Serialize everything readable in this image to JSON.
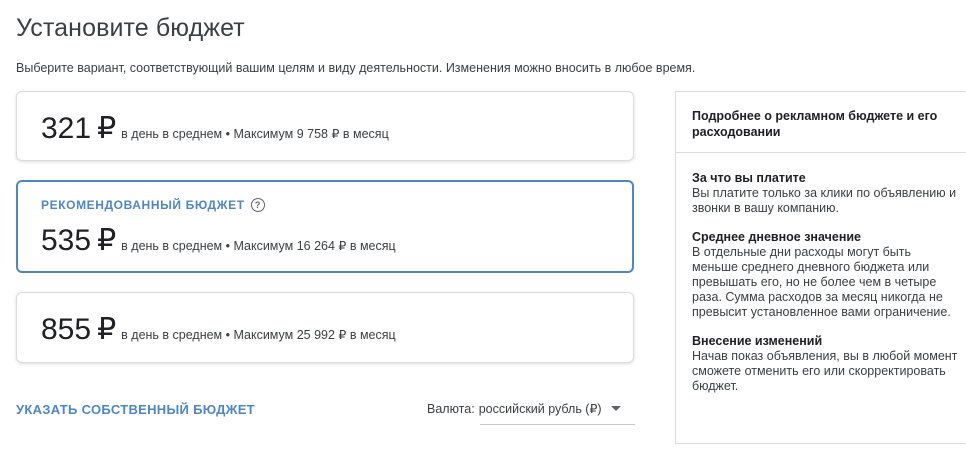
{
  "page": {
    "title": "Установите бюджет",
    "subtitle": "Выберите вариант, соответствующий вашим целям и виду деятельности. Изменения можно вносить в любое время."
  },
  "options": [
    {
      "amount": "321",
      "currency_symbol": "₽",
      "detail": "в день в среднем • Максимум 9 758 ₽ в месяц"
    },
    {
      "badge": "РЕКОМЕНДОВАННЫЙ БЮДЖЕТ",
      "help_icon": "help-circle-icon",
      "help_glyph": "?",
      "amount": "535",
      "currency_symbol": "₽",
      "detail": "в день в среднем • Максимум 16 264 ₽ в месяц",
      "selected": true
    },
    {
      "amount": "855",
      "currency_symbol": "₽",
      "detail": "в день в среднем • Максимум 25 992 ₽ в месяц"
    }
  ],
  "custom_budget_link": "УКАЗАТЬ СОБСТВЕННЫЙ БЮДЖЕТ",
  "currency": {
    "label": "Валюта:",
    "value": "российский рубль (₽)",
    "icon": "dropdown-arrow-icon"
  },
  "info_panel": {
    "header": "Подробнее о рекламном бюджете и его расходовании",
    "sections": [
      {
        "title": "За что вы платите",
        "text": "Вы платите только за клики по объявлению и звонки в вашу компанию."
      },
      {
        "title": "Среднее дневное значение",
        "text": "В отдельные дни расходы могут быть меньше среднего дневного бюджета или превышать его, но не более чем в четыре раза. Сумма расходов за месяц никогда не превысит установленное вами ограничение."
      },
      {
        "title": "Внесение изменений",
        "text": "Начав показ объявления, вы в любой момент сможете отменить его или скорректировать бюджет."
      }
    ]
  },
  "colors": {
    "accent": "#4f86c6",
    "border": "#dadce0",
    "text": "#202124"
  }
}
